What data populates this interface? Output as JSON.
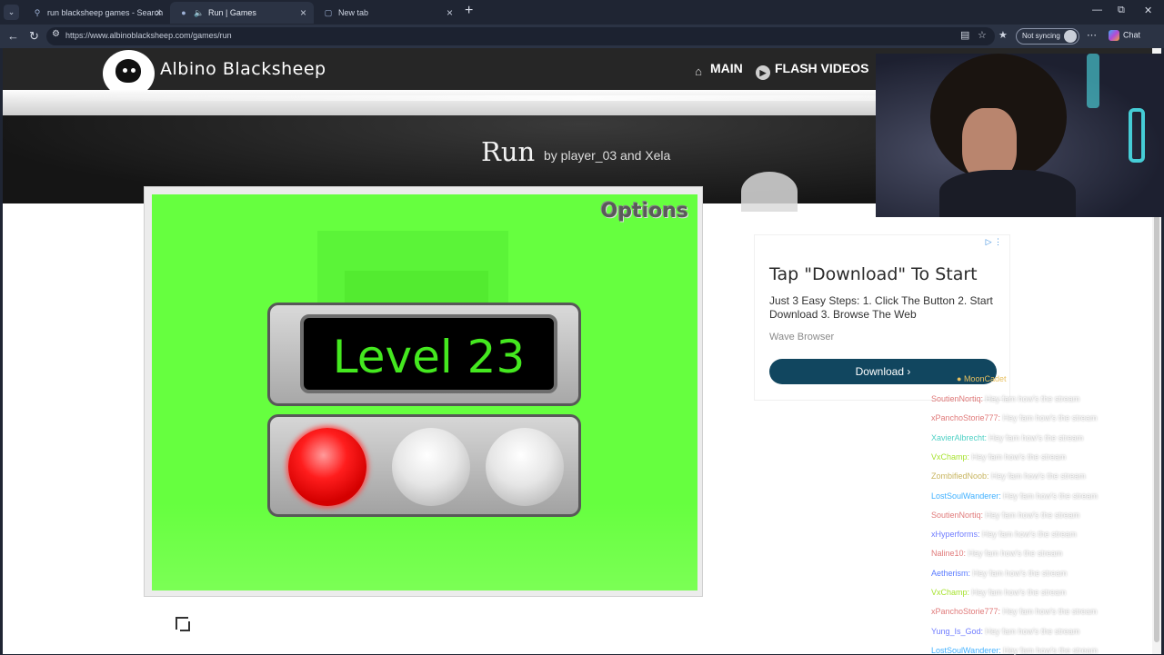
{
  "browser": {
    "tabs": [
      {
        "title": "run blacksheep games - Search",
        "icon": "search-icon",
        "active": false
      },
      {
        "title": "Run | Games",
        "icon": "speaker-icon",
        "active": true
      },
      {
        "title": "New tab",
        "icon": "newtab-icon",
        "active": false
      }
    ],
    "url": "https://www.albinoblacksheep.com/games/run",
    "sync_label": "Not syncing",
    "chat_label": "Chat"
  },
  "site": {
    "name": "Albino Blacksheep",
    "nav": {
      "main": "MAIN",
      "flash": "FLASH VIDEOS"
    }
  },
  "game": {
    "title": "Run",
    "byline": "by player_03 and Xela",
    "options_label": "Options",
    "level_text": "Level 23",
    "lights": [
      {
        "state": "on",
        "color": "#ff1d1d"
      },
      {
        "state": "off",
        "color": "#e6e6e6"
      },
      {
        "state": "off",
        "color": "#e6e6e6"
      }
    ]
  },
  "ad": {
    "headline": "Tap \"Download\" To Start",
    "body": "Just 3 Easy Steps: 1. Click The Button 2. Start Download 3. Browse The Web",
    "brand": "Wave Browser",
    "button_label": "Download"
  },
  "stream_chat": {
    "header_users": [
      "MoonCadet"
    ],
    "messages": [
      {
        "user": "SoutienNortiq",
        "color": "#e07a7a",
        "text": "Hey fam how's the stream"
      },
      {
        "user": "xPanchoStorie777",
        "color": "#e07a7a",
        "text": "Hey fam how's the stream"
      },
      {
        "user": "XavierAlbrecht",
        "color": "#4fd1c5",
        "text": "Hey fam how's the stream"
      },
      {
        "user": "VxChamp",
        "color": "#a6e22e",
        "text": "Hey fam how's the stream"
      },
      {
        "user": "ZombifiedNoob",
        "color": "#c8b560",
        "text": "Hey fam how's the stream"
      },
      {
        "user": "LostSoulWanderer",
        "color": "#3fb0ff",
        "text": "Hey fam how's the stream"
      },
      {
        "user": "SoutienNortiq",
        "color": "#e07a7a",
        "text": "Hey fam how's the stream"
      },
      {
        "user": "xHyperforms",
        "color": "#6f7cff",
        "text": "Hey fam how's the stream"
      },
      {
        "user": "Naline10",
        "color": "#e07a7a",
        "text": "Hey fam how's the stream"
      },
      {
        "user": "Aetherism",
        "color": "#5a7bff",
        "text": "Hey fam how's the stream"
      },
      {
        "user": "VxChamp",
        "color": "#a6e22e",
        "text": "Hey fam how's the stream"
      },
      {
        "user": "xPanchoStorie777",
        "color": "#e07a7a",
        "text": "Hey fam how's the stream"
      },
      {
        "user": "Yung_Is_God",
        "color": "#6f7cff",
        "text": "Hey fam how's the stream"
      },
      {
        "user": "LostSoulWanderer",
        "color": "#3fb0ff",
        "text": "Hey fam how's the stream"
      }
    ]
  }
}
